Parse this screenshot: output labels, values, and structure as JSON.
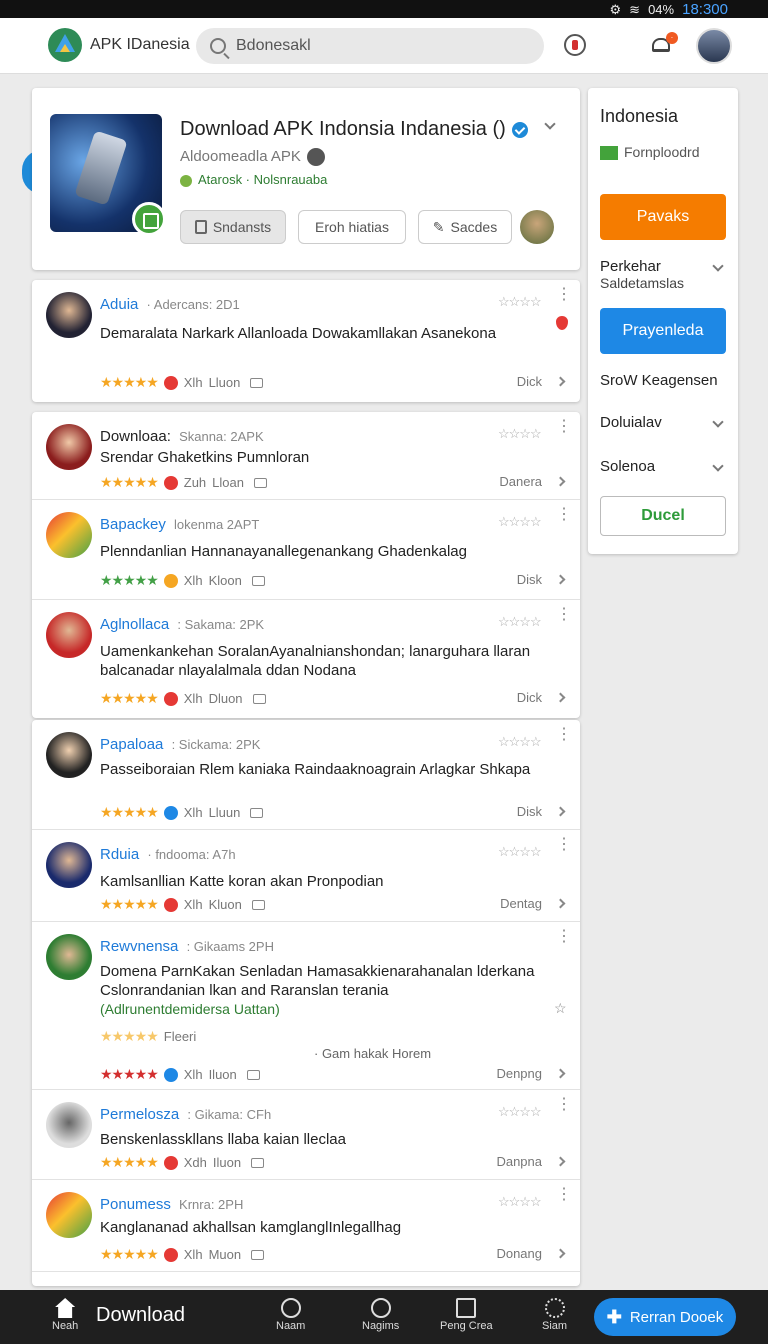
{
  "status": {
    "battery": "04%",
    "time": "18:300"
  },
  "header": {
    "brand": "APK IDanesia",
    "search_value": "Bdonesakl"
  },
  "app": {
    "title": "Download APK Indonsia Indanesia ()",
    "subtitle": "Aldoomeadla APK",
    "tag": "Atarosk · Nolsnrauaba",
    "buttons": [
      "Sndansts",
      "Eroh hiatias",
      "Sacdes"
    ]
  },
  "side": {
    "title": "Indonesia",
    "checkbox_label": "Fornploodrd",
    "btn_orange": "Pavaks",
    "row1": "Perkehar",
    "row1_sub": "Saldetamslas",
    "btn_blue": "Prayenleda",
    "row2": "SroW Keagensen",
    "row3": "Doluialav",
    "row4": "Solenoa",
    "btn_outline": "Ducel"
  },
  "reviews": [
    {
      "name": "Aduia",
      "meta": "· Adercans: 2D1",
      "text": "Demaralata Narkark Allanloada Dowakamllakan Asanekona",
      "foot_a": "Xlh",
      "foot_b": "Lluon",
      "right": "Dick"
    },
    {
      "name": "Downloaa:",
      "meta": "Skanna: 2APK",
      "text": "Srendar Ghaketkins Pumnloran",
      "foot_a": "Zuh",
      "foot_b": "Lloan",
      "right": "Danera"
    },
    {
      "name": "Bapackey",
      "meta": "lokenma 2APT",
      "text": "Plenndanlian Hannanayanallegenankang Ghadenkalag",
      "foot_a": "Xlh",
      "foot_b": "Kloon",
      "right": "Disk"
    },
    {
      "name": "Aglnollaca",
      "meta": ": Sakama: 2PK",
      "text": "Uamenkankehan SoralanAyanalnianshondan; lanarguhara llaran balcanadar nlayalalmala ddan Nodana",
      "foot_a": "Xlh",
      "foot_b": "Dluon",
      "right": "Dick"
    },
    {
      "name": "Papaloaa",
      "meta": ": Sickama: 2PK",
      "text": "Passeiboraian Rlem kaniaka Raindaaknoagrain Arlagkar Shkapa",
      "foot_a": "Xlh",
      "foot_b": "Lluun",
      "right": "Disk"
    },
    {
      "name": "Rduia",
      "meta": "· fndooma: A7h",
      "text": "Kamlsanllian Katte koran akan Pronpodian",
      "foot_a": "Xlh",
      "foot_b": "Kluon",
      "right": "Dentag"
    },
    {
      "name": "Rewvnensa",
      "meta": ": Gikaams 2PH",
      "text": "Domena ParnKakan Senladan Hamasakkienarahanalan lderkana Cslonrandanian lkan and Raranslan terania",
      "extra": "(Adlrunentdemidersa Uattan)",
      "foot_label": "Fleeri",
      "center_note": "· Gam hakak Horem",
      "foot_a": "Xlh",
      "foot_b": "Iluon",
      "right": "Denpng"
    },
    {
      "name": "Permelosza",
      "meta": ": Gikama: CFh",
      "text": "Benskenlasskllans llaba kaian lleclaa",
      "foot_a": "Xdh",
      "foot_b": "Iluon",
      "right": "Danpna"
    },
    {
      "name": "Ponumess",
      "meta": "Krnra: 2PH",
      "text": "Kanglananad akhallsan kamglanglInlegallhag",
      "foot_a": "Xlh",
      "foot_b": "Muon",
      "right": "Donang"
    }
  ],
  "bottom_nav": {
    "home": "Neah",
    "download": "Download",
    "n2": "Naam",
    "n3": "Nagims",
    "n4": "Peng Crea",
    "n5": "Siam",
    "fab": "Rerran Dooek"
  },
  "colors": {
    "accent_blue": "#1e88e5",
    "orange": "#f57c00",
    "green": "#2e9b3a"
  }
}
